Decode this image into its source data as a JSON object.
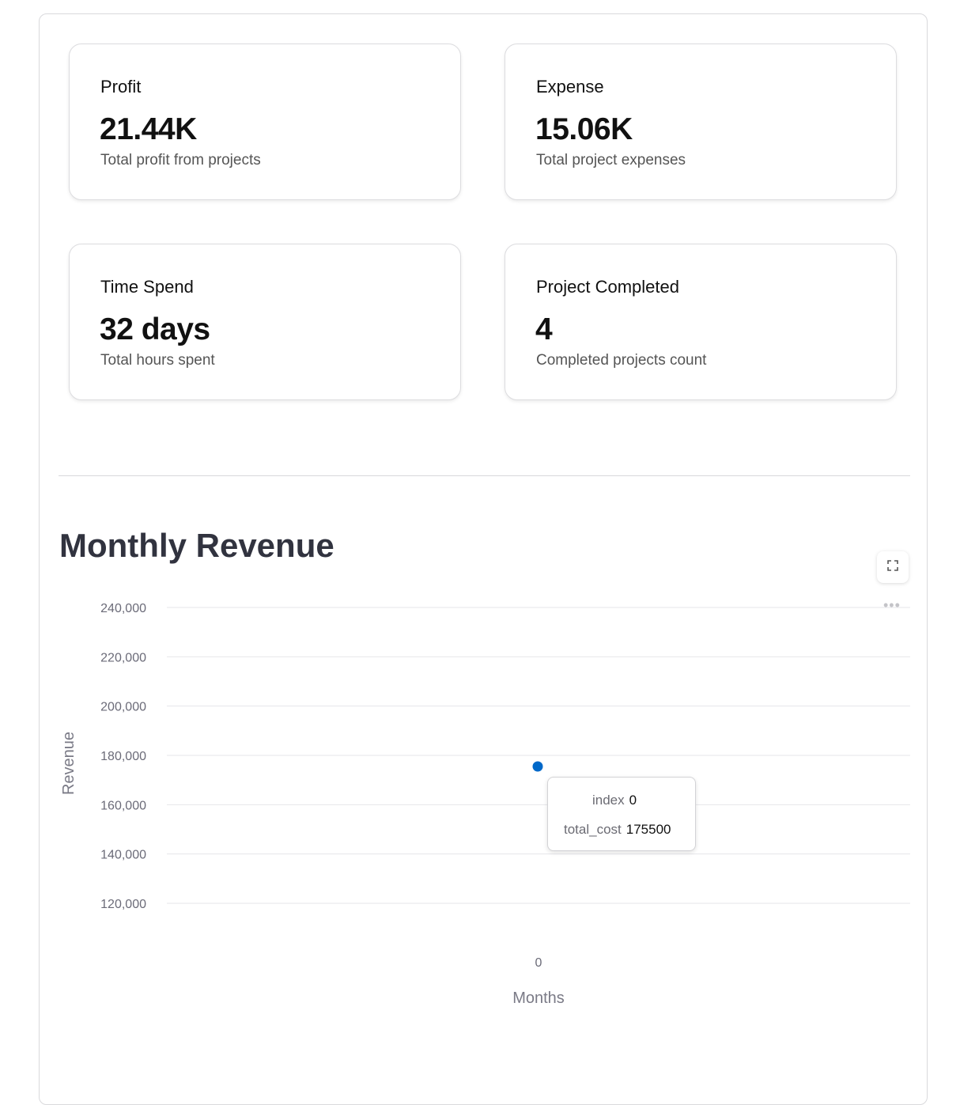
{
  "cards": [
    {
      "label": "Profit",
      "value": "21.44K",
      "desc": "Total profit from projects"
    },
    {
      "label": "Expense",
      "value": "15.06K",
      "desc": "Total project expenses"
    },
    {
      "label": "Time Spend",
      "value": "32 days",
      "desc": "Total hours spent"
    },
    {
      "label": "Project Completed",
      "value": "4",
      "desc": "Completed projects count"
    }
  ],
  "section_title": "Monthly Revenue",
  "chart_data": {
    "type": "scatter",
    "title": "Monthly Revenue",
    "xlabel": "Months",
    "ylabel": "Revenue",
    "x": [
      0
    ],
    "y": [
      175500
    ],
    "y_ticks": [
      "120,000",
      "140,000",
      "160,000",
      "180,000",
      "200,000",
      "220,000",
      "240,000"
    ],
    "y_tick_values": [
      120000,
      140000,
      160000,
      180000,
      200000,
      220000,
      240000
    ],
    "x_ticks": [
      "0"
    ],
    "ylim": [
      120000,
      240000
    ],
    "grid": true,
    "point_color": "#0068c9"
  },
  "tooltip": {
    "index_key": "index",
    "index_value": "0",
    "cost_key": "total_cost",
    "cost_value": "175500"
  },
  "icons": {
    "expand": "fullscreen-expand-icon",
    "menu": "more-horizontal-icon"
  }
}
